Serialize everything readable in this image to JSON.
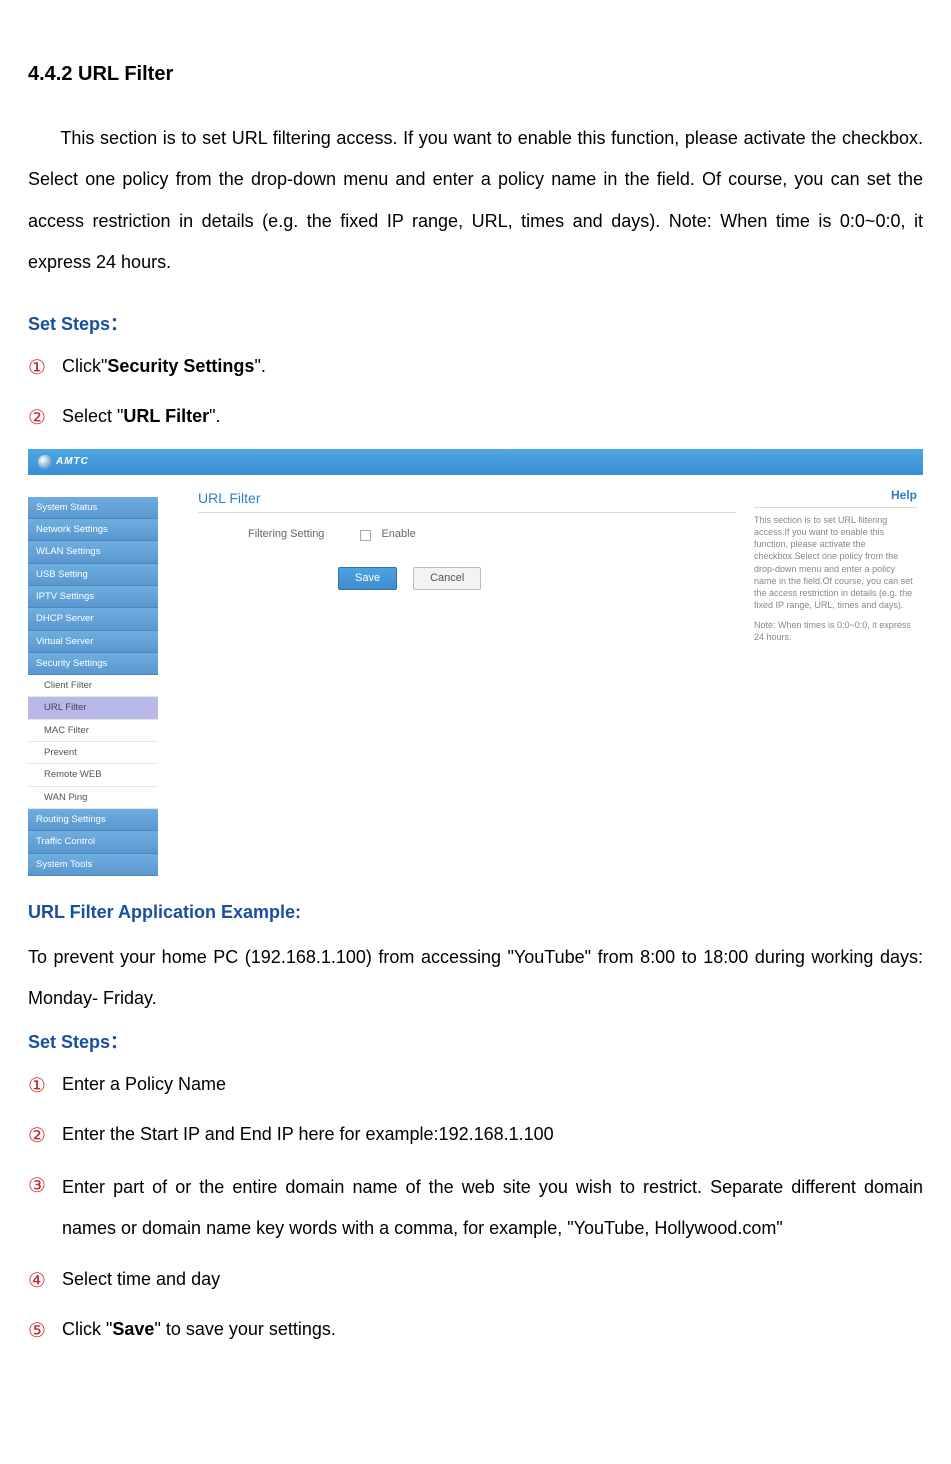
{
  "heading": "4.4.2 URL Filter",
  "intro": "This section is to set URL filtering access. If you want to enable this function, please activate the checkbox. Select one policy from the drop-down menu and enter a policy name in the field. Of course, you can set the access restriction in details (e.g. the fixed IP range, URL, times and days). Note: When time is 0:0~0:0, it express 24 hours.",
  "set_steps_label": "Set Steps：",
  "steps_top": {
    "s1_pre": "Click\"",
    "s1_bold": "Security Settings",
    "s1_post": "\".",
    "s2_pre": "Select \"",
    "s2_bold": "URL Filter",
    "s2_post": "\"."
  },
  "circles": {
    "c1": "①",
    "c2": "②",
    "c3": "③",
    "c4": "④",
    "c5": "⑤"
  },
  "ui": {
    "logo": "AMTC",
    "sidebar": [
      {
        "t": "m",
        "label": "System Status"
      },
      {
        "t": "m",
        "label": "Network Settings"
      },
      {
        "t": "m",
        "label": "WLAN Settings"
      },
      {
        "t": "m",
        "label": "USB Setting"
      },
      {
        "t": "m",
        "label": "IPTV Settings"
      },
      {
        "t": "m",
        "label": "DHCP Server"
      },
      {
        "t": "m",
        "label": "Virtual Server"
      },
      {
        "t": "m",
        "label": "Security Settings"
      },
      {
        "t": "s",
        "label": "Client Filter"
      },
      {
        "t": "ssel",
        "label": "URL Filter"
      },
      {
        "t": "s",
        "label": "MAC Filter"
      },
      {
        "t": "s",
        "label": "Prevent"
      },
      {
        "t": "s",
        "label": "Remote WEB"
      },
      {
        "t": "s",
        "label": "WAN Ping"
      },
      {
        "t": "m",
        "label": "Routing Settings"
      },
      {
        "t": "m",
        "label": "Traffic Control"
      },
      {
        "t": "m",
        "label": "System Tools"
      }
    ],
    "main_title": "URL Filter",
    "filtering_label": "Filtering Setting",
    "enable_label": "Enable",
    "save": "Save",
    "cancel": "Cancel",
    "help_title": "Help",
    "help_body": "This section is to set URL filtering access.If you want to enable this function, please activate the checkbox.Select one policy from the drop-down menu and enter a policy name in the field.Of course, you can set the access restriction in details (e.g. the fixed IP range, URL, times and days).",
    "help_note": "Note: When times is 0:0~0:0, it express 24 hours."
  },
  "example_head": "URL Filter Application Example:",
  "example_body": "To prevent your home PC (192.168.1.100) from accessing \"YouTube\" from 8:00 to 18:00 during working days: Monday- Friday.",
  "steps_bottom": {
    "s1": "Enter a Policy Name",
    "s2": "Enter the Start IP and End IP here for example:192.168.1.100",
    "s3": "Enter part of or the entire domain name of the web site you wish to restrict. Separate different domain names or domain name key words with a comma, for example, \"YouTube, Hollywood.com\"",
    "s4": "Select time and day",
    "s5_pre": "Click \"",
    "s5_bold": "Save",
    "s5_post": "\" to save your settings."
  }
}
